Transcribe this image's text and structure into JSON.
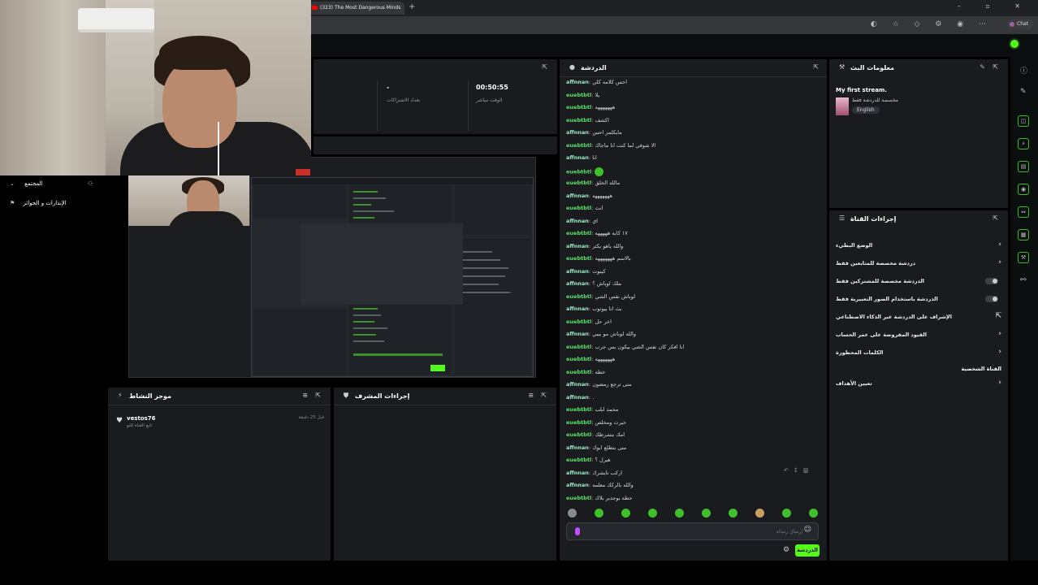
{
  "browser": {
    "tab_title": "(323) The Most Dangerous Minds",
    "chat_button": "Chat"
  },
  "stats": {
    "uptime_value": "00:50:55",
    "uptime_label": "الوقت مباشر",
    "subs_value": "-",
    "subs_label": "تعداد الاشتراكات"
  },
  "community": {
    "title": "المجتمع",
    "item": "الإنذارات و الجوائز"
  },
  "activity": {
    "title": "موجز النشاط",
    "item_user": "vestos76",
    "item_text": "تابع القناة للتو",
    "item_time": "قبل 25 دقيقة"
  },
  "mod": {
    "title": "إجراءات المشرف"
  },
  "chat": {
    "title": "الدردشة",
    "placeholder": "إرسال رسالة",
    "send_label": "الدردشة",
    "user_colors": {
      "affnnan": "#9be8c2",
      "euebtbtl": "#5ce16a"
    },
    "messages": [
      {
        "user": "affnnan",
        "text": "احس كلامه كلي"
      },
      {
        "user": "euebtbtl",
        "text": "يلا"
      },
      {
        "user": "euebtbtl",
        "text": "هههههههه"
      },
      {
        "user": "euebtbtl",
        "text": "اكشف"
      },
      {
        "user": "affnnan",
        "text": "مايكلمر احس"
      },
      {
        "user": "euebtbtl",
        "text": "الا شوفي لما كنت انا ماجاك"
      },
      {
        "user": "affnnan",
        "text": "انا"
      },
      {
        "user": "euebtbtl",
        "text": ""
      },
      {
        "user": "euebtbtl",
        "text": "مالله الخلق"
      },
      {
        "user": "affnnan",
        "text": "هههههههه"
      },
      {
        "user": "euebtbtl",
        "text": "انت"
      },
      {
        "user": "affnnan",
        "text": "اي"
      },
      {
        "user": "euebtbtl",
        "text": "١٧ كابه هههههه"
      },
      {
        "user": "affnnan",
        "text": "والله ياهو يكثر"
      },
      {
        "user": "euebtbtl",
        "text": "بالاسم هههههههه"
      },
      {
        "user": "affnnan",
        "text": "كيبوت"
      },
      {
        "user": "affnnan",
        "text": "ملك لوباش ؟"
      },
      {
        "user": "euebtbtl",
        "text": "لوباش نفس الشي"
      },
      {
        "user": "affnnan",
        "text": "بث انا بيوتوب"
      },
      {
        "user": "euebtbtl",
        "text": "اخر حل"
      },
      {
        "user": "affnnan",
        "text": "والله لوباش مو بيبي"
      },
      {
        "user": "euebtbtl",
        "text": "انا افكر كان نفس الشي بيكون بس جرب"
      },
      {
        "user": "euebtbtl",
        "text": "هههههههه"
      },
      {
        "user": "euebtbtl",
        "text": "خطه"
      },
      {
        "user": "affnnan",
        "text": "متى ترجع رمضون"
      },
      {
        "user": "affnnan",
        "text": "."
      },
      {
        "user": "euebtbtl",
        "text": "محمد ابلب"
      },
      {
        "user": "euebtbtl",
        "text": "حيرت ومخلص"
      },
      {
        "user": "euebtbtl",
        "text": "امك بتشرطك"
      },
      {
        "user": "affnnan",
        "text": "متى بتطلع ابوك"
      },
      {
        "user": "euebtbtl",
        "text": "هيرل ؟"
      },
      {
        "user": "affnnan",
        "text": "اركب تابشرك"
      },
      {
        "user": "affnnan",
        "text": "والله بالركك معلمه"
      },
      {
        "user": "euebtbtl",
        "text": "حطه بوجدير بلاك"
      }
    ]
  },
  "stream_info": {
    "title": "معلومات البث",
    "stream_title": "My first stream.",
    "category": "مخصصة للدردشة فقط",
    "language": "English"
  },
  "channel_actions": {
    "title": "إجراءات القناة",
    "items": [
      {
        "label": "الوضع البطيء",
        "control": "chevron"
      },
      {
        "label": "دردشة مخصصة للمتابعين فقط",
        "control": "chevron"
      },
      {
        "label": "الدردشة مخصصة للمشتركين فقط",
        "control": "toggle"
      },
      {
        "label": "الدردشة باستخدام الصور التعبيرية فقط",
        "control": "toggle"
      },
      {
        "label": "الإشراف على الدردشة عبر الذكاء الاصطناعي",
        "control": "external"
      },
      {
        "label": "القيود المفروضة على عمر الحساب",
        "control": "chevron"
      },
      {
        "label": "الكلمات المحظورة",
        "control": "chevron"
      }
    ],
    "section": "القناة الشخصية",
    "goals": "تعيين الأهداف"
  }
}
